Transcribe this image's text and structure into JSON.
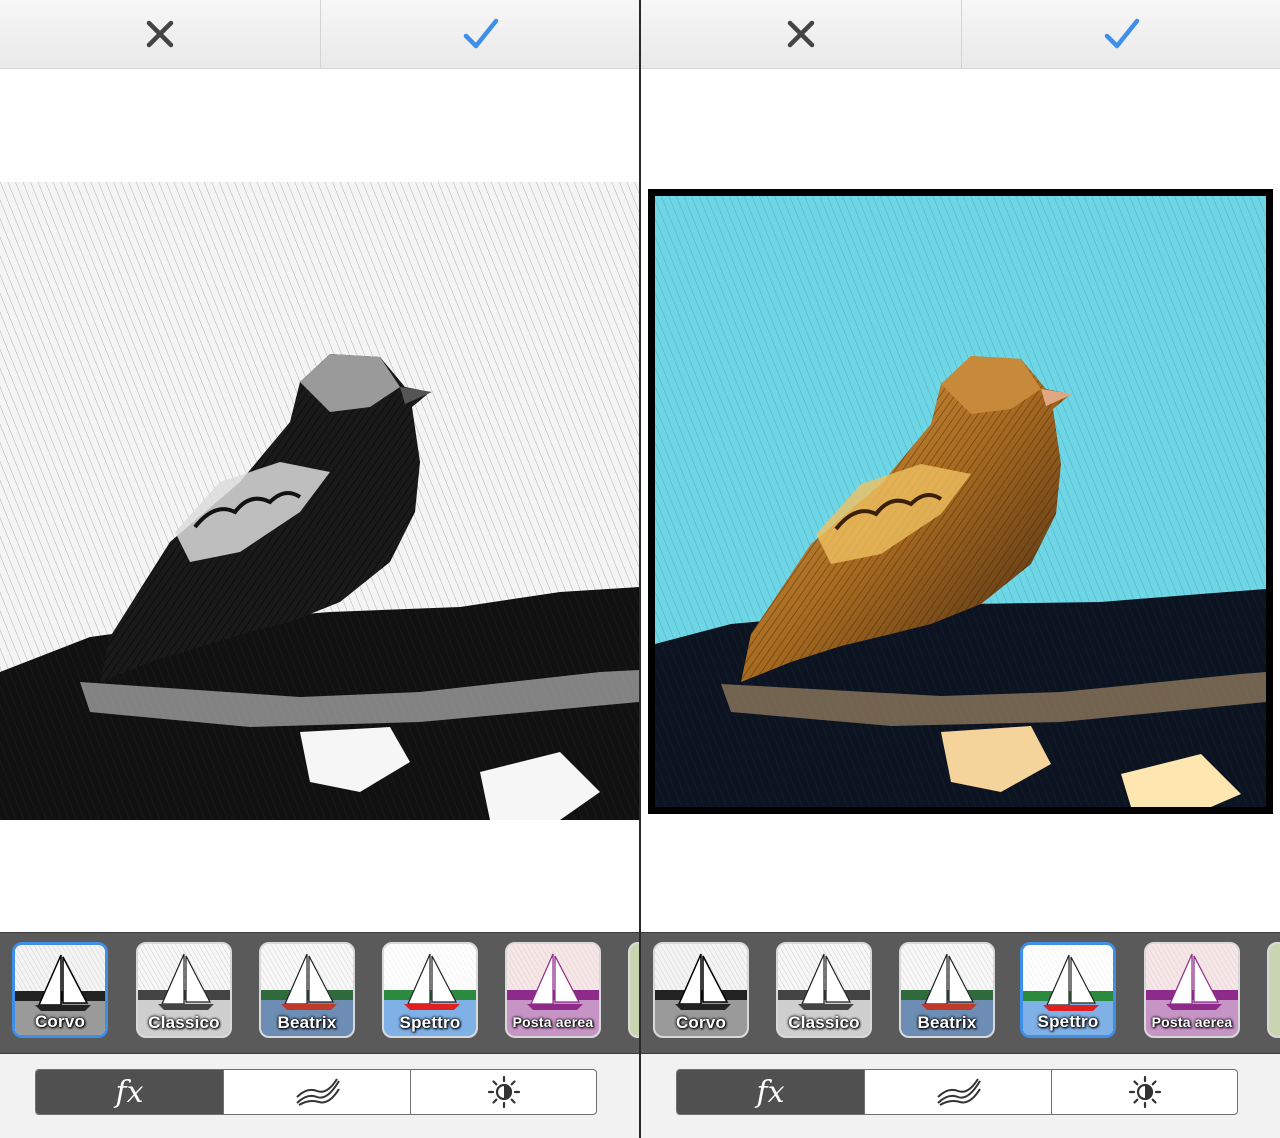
{
  "panels": [
    {
      "id": "left",
      "top_bar": {
        "cancel_icon": "close-icon",
        "confirm_icon": "checkmark-icon",
        "confirm_color": "#3d8fe8"
      },
      "photo": {
        "subject": "sparrow",
        "style": "black-and-white engraving",
        "border": false
      },
      "filters": [
        {
          "label": "Corvo",
          "selected": true
        },
        {
          "label": "Classico",
          "selected": false
        },
        {
          "label": "Beatrix",
          "selected": false
        },
        {
          "label": "Spettro",
          "selected": false
        },
        {
          "label": "Posta aerea",
          "selected": false
        }
      ],
      "tabs": {
        "effects": "fx",
        "texture_icon": "waves-icon",
        "adjust_icon": "brightness-icon",
        "active": "effects"
      }
    },
    {
      "id": "right",
      "top_bar": {
        "cancel_icon": "close-icon",
        "confirm_icon": "checkmark-icon",
        "confirm_color": "#3d8fe8"
      },
      "photo": {
        "subject": "sparrow",
        "style": "color engraving, cyan sky",
        "border": true
      },
      "filters": [
        {
          "label": "Corvo",
          "selected": false
        },
        {
          "label": "Classico",
          "selected": false
        },
        {
          "label": "Beatrix",
          "selected": false
        },
        {
          "label": "Spettro",
          "selected": true
        },
        {
          "label": "Posta aerea",
          "selected": false
        }
      ],
      "tabs": {
        "effects": "fx",
        "texture_icon": "waves-icon",
        "adjust_icon": "brightness-icon",
        "active": "effects"
      }
    }
  ],
  "colors": {
    "selection": "#3d8fe8",
    "sky_color": "#6fd6e6",
    "strip_bg": "#5a5a5a"
  }
}
